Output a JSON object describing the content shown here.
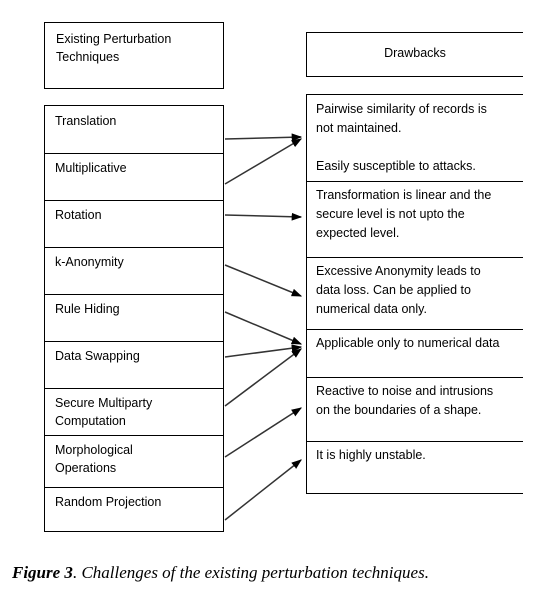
{
  "figure": {
    "caption_label": "Figure 3",
    "caption_separator": ". ",
    "caption_body": "Challenges of the existing perturbation techniques."
  },
  "left_column": {
    "header": "Existing Perturbation\nTechniques",
    "items": [
      {
        "label": "Translation"
      },
      {
        "label": "Multiplicative"
      },
      {
        "label": "Rotation"
      },
      {
        "label": "k-Anonymity"
      },
      {
        "label": "Rule Hiding"
      },
      {
        "label": "Data Swapping"
      },
      {
        "label": "Secure Multiparty\nComputation"
      },
      {
        "label": "Morphological\nOperations"
      },
      {
        "label": "Random Projection"
      }
    ]
  },
  "right_column": {
    "header": "Drawbacks",
    "items": [
      {
        "label": "Pairwise similarity of records is\nnot maintained.\n\nEasily susceptible to attacks."
      },
      {
        "label": "Transformation is linear and the\nsecure level is not upto the\nexpected level."
      },
      {
        "label": "Excessive Anonymity leads to\ndata loss. Can be applied to\nnumerical data only."
      },
      {
        "label": "Applicable only to numerical data"
      },
      {
        "label": "Reactive to noise and intrusions\non the boundaries of a shape."
      },
      {
        "label": "It is highly unstable."
      }
    ]
  },
  "colors": {
    "stroke": "#000000",
    "background": "#ffffff",
    "text": "#000000"
  }
}
